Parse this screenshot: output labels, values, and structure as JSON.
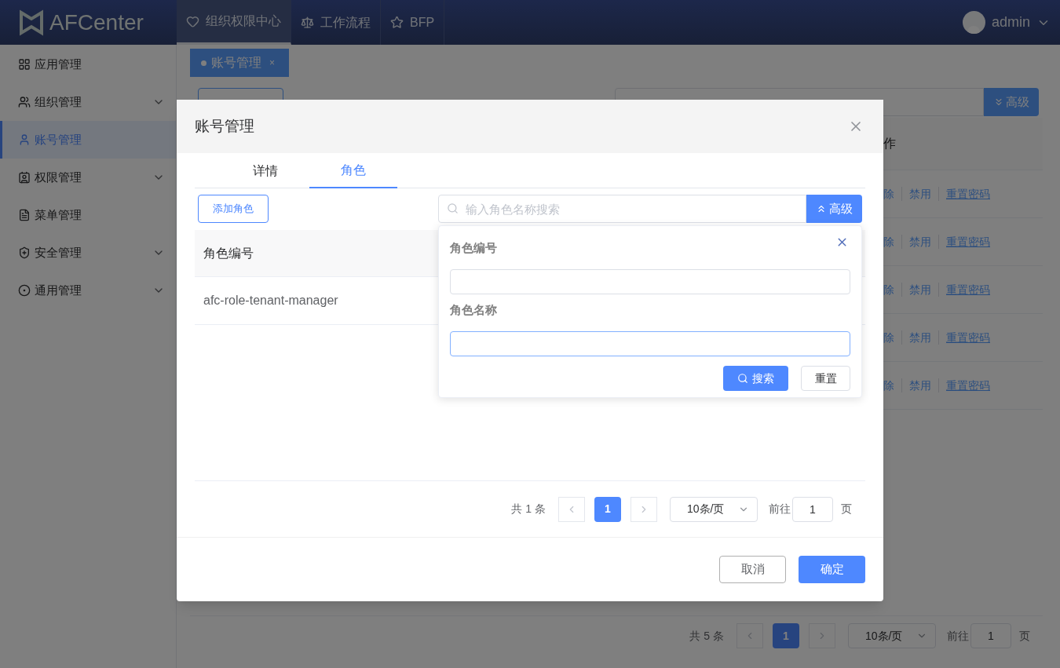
{
  "header": {
    "logo": "AFCenter",
    "nav": [
      {
        "label": "组织权限中心",
        "selected": true
      },
      {
        "label": "工作流程",
        "selected": false
      },
      {
        "label": "BFP",
        "selected": false
      }
    ],
    "user": "admin"
  },
  "sidebar": {
    "items": [
      {
        "label": "应用管理",
        "expandable": false,
        "selected": false
      },
      {
        "label": "组织管理",
        "expandable": true,
        "selected": false
      },
      {
        "label": "账号管理",
        "expandable": false,
        "selected": true
      },
      {
        "label": "权限管理",
        "expandable": true,
        "selected": false
      },
      {
        "label": "菜单管理",
        "expandable": false,
        "selected": false
      },
      {
        "label": "安全管理",
        "expandable": true,
        "selected": false
      },
      {
        "label": "通用管理",
        "expandable": true,
        "selected": false
      }
    ]
  },
  "page_tab": {
    "label": "账号管理",
    "close": "×"
  },
  "background": {
    "advanced_button": "高级",
    "column_header": "作",
    "rows": [
      {
        "actions": [
          "除",
          "禁用",
          "重置密码"
        ]
      },
      {
        "actions": [
          "除",
          "禁用",
          "重置密码"
        ]
      },
      {
        "actions": [
          "除",
          "禁用",
          "重置密码"
        ]
      },
      {
        "actions": [
          "除",
          "禁用",
          "重置密码"
        ]
      },
      {
        "actions": [
          "除",
          "禁用",
          "重置密码"
        ]
      }
    ],
    "pagination": {
      "total": "共 5 条",
      "pages": [
        {
          "label": "1",
          "selected": true
        }
      ],
      "page_size": "10条/页",
      "goto": "前往",
      "goto_value": "1",
      "page_unit": "页"
    }
  },
  "dialog": {
    "title": "账号管理",
    "tabs": [
      {
        "label": "详情",
        "selected": false
      },
      {
        "label": "角色",
        "selected": true
      }
    ],
    "add_button": "添加角色",
    "search": {
      "placeholder": "输入角色名称搜索",
      "advanced_button": "高级"
    },
    "filter": {
      "fields": [
        {
          "label": "角色编号",
          "focused": false
        },
        {
          "label": "角色名称",
          "focused": true
        }
      ],
      "search_button": "搜索",
      "reset_button": "重置"
    },
    "table": {
      "columns": [
        "角色编号"
      ],
      "rows": [
        [
          "afc-role-tenant-manager"
        ]
      ]
    },
    "pagination": {
      "total": "共 1 条",
      "pages": [
        {
          "label": "1",
          "selected": true
        }
      ],
      "page_size": "10条/页",
      "goto": "前往",
      "goto_value": "1",
      "page_unit": "页"
    },
    "buttons": [
      {
        "label": "取消",
        "kind": "secondary"
      },
      {
        "label": "确定",
        "kind": "primary"
      }
    ]
  }
}
